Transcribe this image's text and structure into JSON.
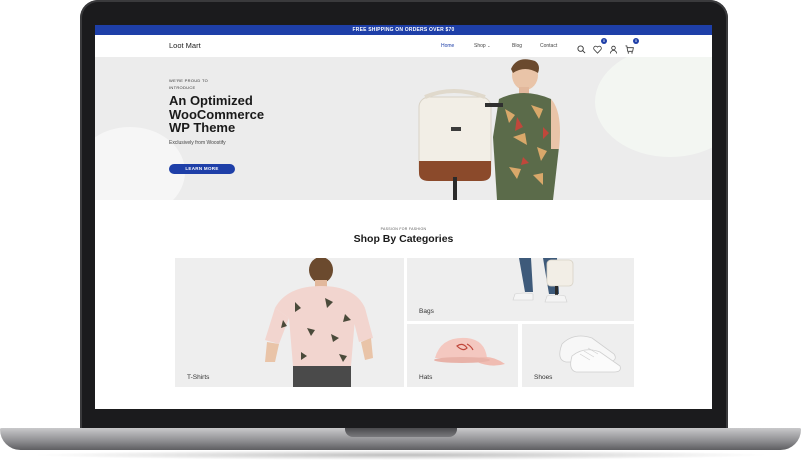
{
  "announcement": "FREE SHIPPING ON ORDERS OVER $70",
  "logo": "Loot Mart",
  "nav": {
    "home": "Home",
    "shop": "Shop",
    "blog": "Blog",
    "contact": "Contact",
    "wishlist_count": "0",
    "cart_count": "0"
  },
  "hero": {
    "eyebrow": "WE'RE PROUD TO INTRODUCE",
    "title_line1": "An Optimized",
    "title_line2": "WooCommerce",
    "title_line3": "WP Theme",
    "subtitle": "Exclusively from Woostify",
    "button": "LEARN MORE"
  },
  "categories": {
    "eyebrow": "PASSION FOR FASHION",
    "title": "Shop By Categories",
    "items": [
      "T-Shirts",
      "Bags",
      "Hats",
      "Shoes"
    ]
  },
  "colors": {
    "accent": "#1e3fa8",
    "hero_bg": "#ececec",
    "tile_bg": "#eeeeee"
  }
}
